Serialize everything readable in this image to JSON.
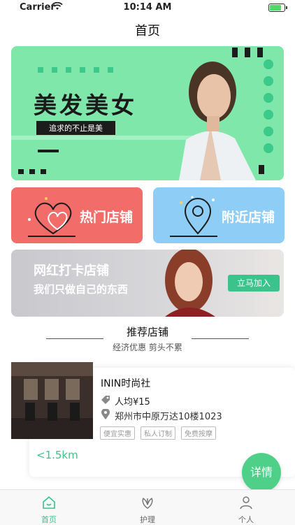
{
  "status_bar": {
    "carrier": "Carrier",
    "time": "10:14 AM",
    "battery_level": 0.8
  },
  "nav": {
    "title": "首页"
  },
  "banner": {
    "headline": "美发美女",
    "tagline": "追求的不止是美",
    "accent_color": "#7fe7a9"
  },
  "cards": [
    {
      "label": "热门店铺",
      "icon": "heart-icon",
      "color": "#f26c6a"
    },
    {
      "label": "附近店铺",
      "icon": "location-pin-icon",
      "color": "#8dcdf6"
    }
  ],
  "promo": {
    "title": "网红打卡店铺",
    "subtitle": "我们只做自己的东西",
    "button": "立马加入",
    "accent_color": "#3cc28b"
  },
  "recommend": {
    "title": "推荐店铺",
    "subtitle": "经济优惠 剪头不累"
  },
  "shop": {
    "name": "ININ时尚社",
    "price": "人均¥15",
    "address": "郑州市中原万达10楼1023",
    "tags": [
      "便宜实惠",
      "私人订制",
      "免费按摩"
    ],
    "distance": "<1.5km"
  },
  "details_button": "详情",
  "tabs": [
    {
      "label": "首页",
      "icon": "home-icon",
      "active": true
    },
    {
      "label": "护理",
      "icon": "care-icon",
      "active": false
    },
    {
      "label": "个人",
      "icon": "person-icon",
      "active": false
    }
  ]
}
